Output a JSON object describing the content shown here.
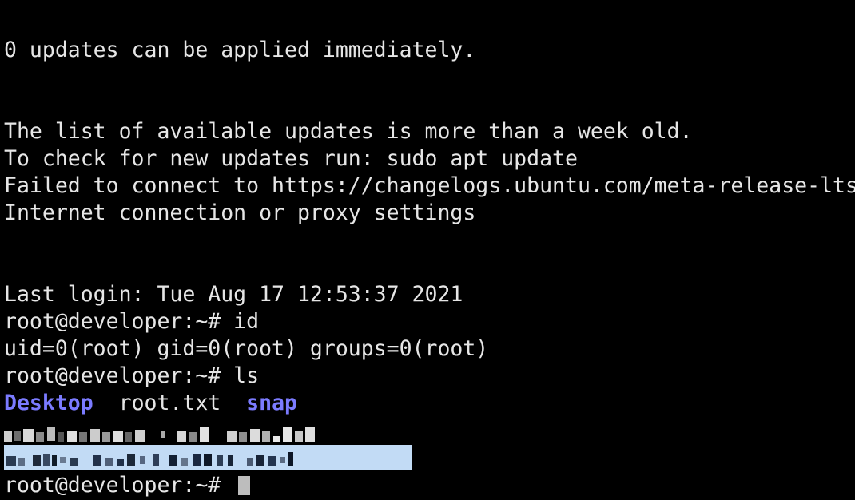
{
  "terminal": {
    "lines": {
      "updates": "0 updates can be applied immediately.",
      "list_old": "The list of available updates is more than a week old.",
      "check_updates": "To check for new updates run: sudo apt update",
      "failed_connect": "Failed to connect to https://changelogs.ubuntu.com/meta-release-lts. Check your",
      "internet": "Internet connection or proxy settings",
      "last_login": "Last login: Tue Aug 17 12:53:37 2021",
      "prompt_id": "root@developer:~# id",
      "id_output": "uid=0(root) gid=0(root) groups=0(root)",
      "prompt_ls": "root@developer:~# ls"
    },
    "ls_output": {
      "desktop": "Desktop",
      "sep1": "  ",
      "root_txt": "root.txt",
      "sep2": "  ",
      "snap": "snap"
    },
    "final_prompt": "root@developer:~# ",
    "colors": {
      "background": "#000000",
      "text": "#e6e6e6",
      "directory": "#7b7bff",
      "selection": "#c2dbf5",
      "cursor": "#bdbdbd"
    }
  }
}
